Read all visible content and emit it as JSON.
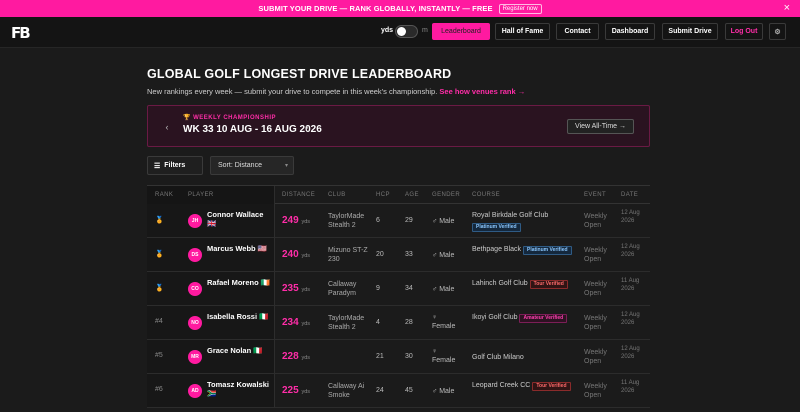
{
  "banner": {
    "text": "SUBMIT YOUR DRIVE — RANK GLOBALLY, INSTANTLY — FREE",
    "link": "Register now",
    "close": "×"
  },
  "nav": {
    "logo": "FB",
    "units_label": "yds",
    "units_alt": "m",
    "units_toggle_on": false,
    "items": [
      {
        "label": "Leaderboard",
        "active": true
      },
      {
        "label": "Hall of Fame",
        "active": false
      },
      {
        "label": "Contact",
        "active": false
      },
      {
        "label": "Dashboard",
        "active": false
      },
      {
        "label": "Submit Drive",
        "active": false
      },
      {
        "label": "Log Out",
        "active": false
      }
    ],
    "settings_icon": "⚙"
  },
  "page": {
    "title": "GLOBAL GOLF LONGEST DRIVE LEADERBOARD",
    "subtitle": "New rankings every week — submit your drive to compete in this week's championship.",
    "subtitle_link": "See how venues rank →"
  },
  "championship": {
    "label": "🏆 WEEKLY CHAMPIONSHIP",
    "week": "WK 33 10 AUG - 16 AUG 2026",
    "prev": "‹",
    "next": "›",
    "view_all": "View All-Time →"
  },
  "controls": {
    "filters": "Filters",
    "sort": "Sort: Distance"
  },
  "table": {
    "headers": [
      "RANK",
      "PLAYER",
      "DISTANCE",
      "CLUB",
      "HCP",
      "AGE",
      "GENDER",
      "COURSE",
      "EVENT",
      "DATE"
    ],
    "rows": [
      {
        "rank": "🏅",
        "initials": "JH",
        "name": "Connor Wallace",
        "flag": "🇬🇧",
        "distance": "249",
        "unit": "yds",
        "club": "TaylorMade Stealth 2",
        "hcp": "6",
        "age": "29",
        "gender": "♂ Male",
        "course": "Royal Birkdale Golf Club",
        "badge": "Platinum Verified",
        "badge_type": "plat",
        "event": "Weekly Open",
        "date": "12 Aug 2026"
      },
      {
        "rank": "🏅",
        "initials": "DS",
        "name": "Marcus Webb",
        "flag": "🇺🇸",
        "distance": "240",
        "unit": "yds",
        "club": "Mizuno ST-Z 230",
        "hcp": "20",
        "age": "33",
        "gender": "♂ Male",
        "course": "Bethpage Black",
        "badge": "Platinum Verified",
        "badge_type": "plat",
        "event": "Weekly Open",
        "date": "12 Aug 2026"
      },
      {
        "rank": "🏅",
        "initials": "CO",
        "name": "Rafael Moreno",
        "flag": "🇮🇪",
        "distance": "235",
        "unit": "yds",
        "club": "Callaway Paradym",
        "hcp": "9",
        "age": "34",
        "gender": "♂ Male",
        "course": "Lahinch Golf Club",
        "badge": "Tour Verified",
        "badge_type": "tour",
        "event": "Weekly Open",
        "date": "11 Aug 2026"
      },
      {
        "rank": "#4",
        "initials": "NO",
        "name": "Isabella Rossi",
        "flag": "🇮🇹",
        "distance": "234",
        "unit": "yds",
        "club": "TaylorMade Stealth 2",
        "hcp": "4",
        "age": "28",
        "gender": "♀ Female",
        "course": "Ikoyi Golf Club",
        "badge": "Amateur Verified",
        "badge_type": "amat",
        "event": "Weekly Open",
        "date": "12 Aug 2026"
      },
      {
        "rank": "#5",
        "initials": "MR",
        "name": "Grace Nolan",
        "flag": "🇮🇹",
        "distance": "228",
        "unit": "yds",
        "club": "",
        "hcp": "21",
        "age": "30",
        "gender": "♀ Female",
        "course": "Golf Club Milano",
        "badge": "",
        "badge_type": "",
        "event": "Weekly Open",
        "date": "12 Aug 2026"
      },
      {
        "rank": "#6",
        "initials": "AD",
        "name": "Tomasz Kowalski",
        "flag": "🇿🇦",
        "distance": "225",
        "unit": "yds",
        "club": "Callaway Ai Smoke",
        "hcp": "24",
        "age": "45",
        "gender": "♂ Male",
        "course": "Leopard Creek CC",
        "badge": "Tour Verified",
        "badge_type": "tour",
        "event": "Weekly Open",
        "date": "11 Aug 2026"
      }
    ]
  },
  "colors": {
    "accent": "#ff1aa0",
    "background": "#1b1b1b",
    "platinum": "#8cc8ff",
    "tour": "#ff6b6b"
  }
}
